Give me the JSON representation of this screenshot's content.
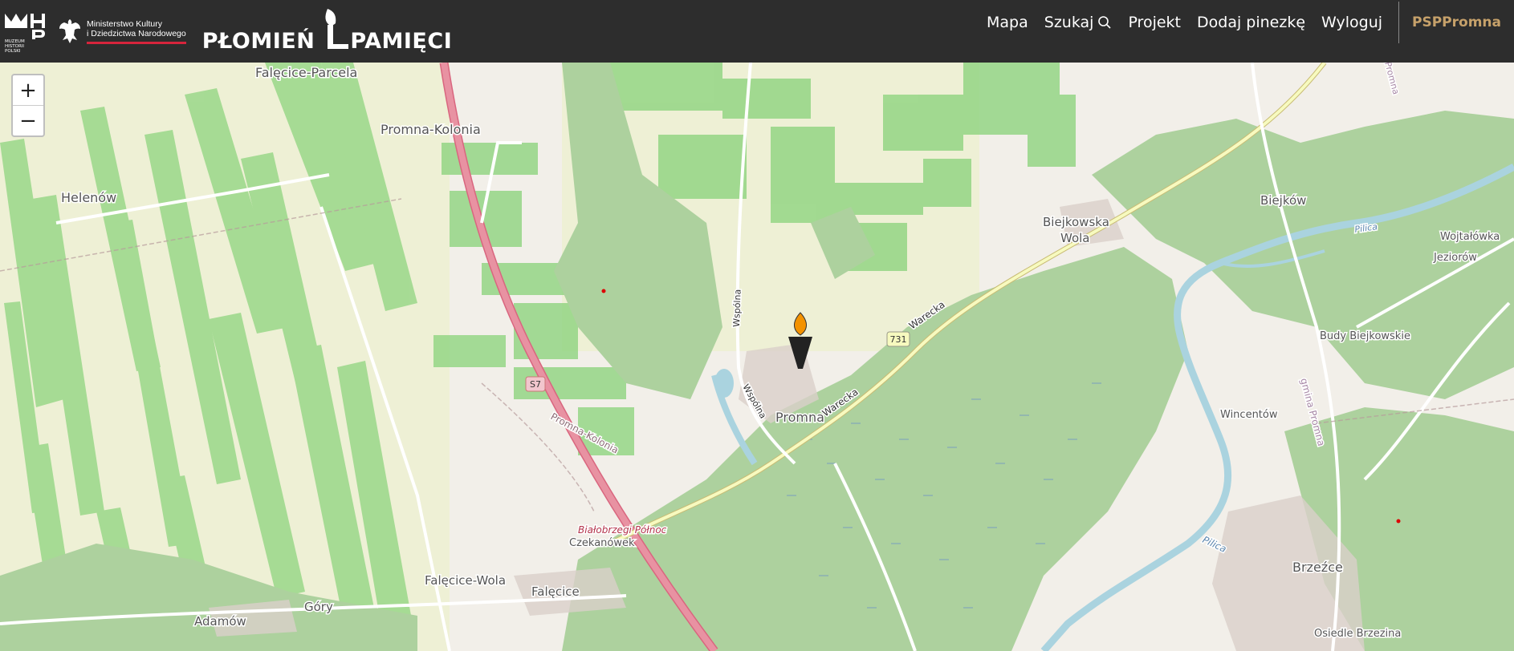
{
  "header": {
    "museum_small": "MUZEUM HISTORII POLSKI",
    "ministry_line1": "Ministerstwo Kultury",
    "ministry_line2": "i Dziedzictwa Narodowego",
    "brand_left": "PŁOMIEŃ",
    "brand_right": "PAMIĘCI",
    "nav": {
      "map": "Mapa",
      "search": "Szukaj",
      "project": "Projekt",
      "add_pin": "Dodaj pinezkę",
      "logout": "Wyloguj",
      "user": "PSPPromna"
    }
  },
  "map": {
    "zoom_in": "+",
    "zoom_out": "−",
    "places": {
      "falecice_parcela": "Falęcice-Parcela",
      "promna_kolonia": "Promna-Kolonia",
      "helenow": "Helenów",
      "biejkowska_wola_1": "Biejkowska",
      "biejkowska_wola_2": "Wola",
      "biejkow": "Biejków",
      "wojtalowka": "Wojtałówka",
      "jeziorow": "Jeziorów",
      "budy_biejkowskie": "Budy Biejkowskie",
      "wincentow": "Wincentów",
      "promna": "Promna",
      "brzezce": "Brzeźce",
      "osiedle_brzezina": "Osiedle Brzezina",
      "czekanowek": "Czekanówek",
      "bialobrzegi_polnoc": "Białobrzegi Północ",
      "falecice_wola": "Falęcice-Wola",
      "falecice": "Falęcice",
      "gory": "Góry",
      "adamow": "Adamów",
      "promna_kolonia_road": "Promna-Kolonia",
      "gmina_promna": "gmina Promna",
      "pilica_1": "Pilica",
      "pilica_2": "Pilica",
      "promna_top": "Promna"
    },
    "roads": {
      "s7": "S7",
      "r731": "731",
      "warecka_1": "Warecka",
      "warecka_2": "Warecka",
      "wspolna_1": "Wspólna",
      "wspolna_2": "Wspólna"
    }
  },
  "colors": {
    "header_bg": "#2d2d2d",
    "user_accent": "#c6a16a",
    "forest": "#add19e",
    "field": "#f2efe9",
    "farmland": "#eef0d5",
    "water": "#aad3df",
    "motorway": "#e892a2",
    "pin_flame": "#f39200"
  }
}
